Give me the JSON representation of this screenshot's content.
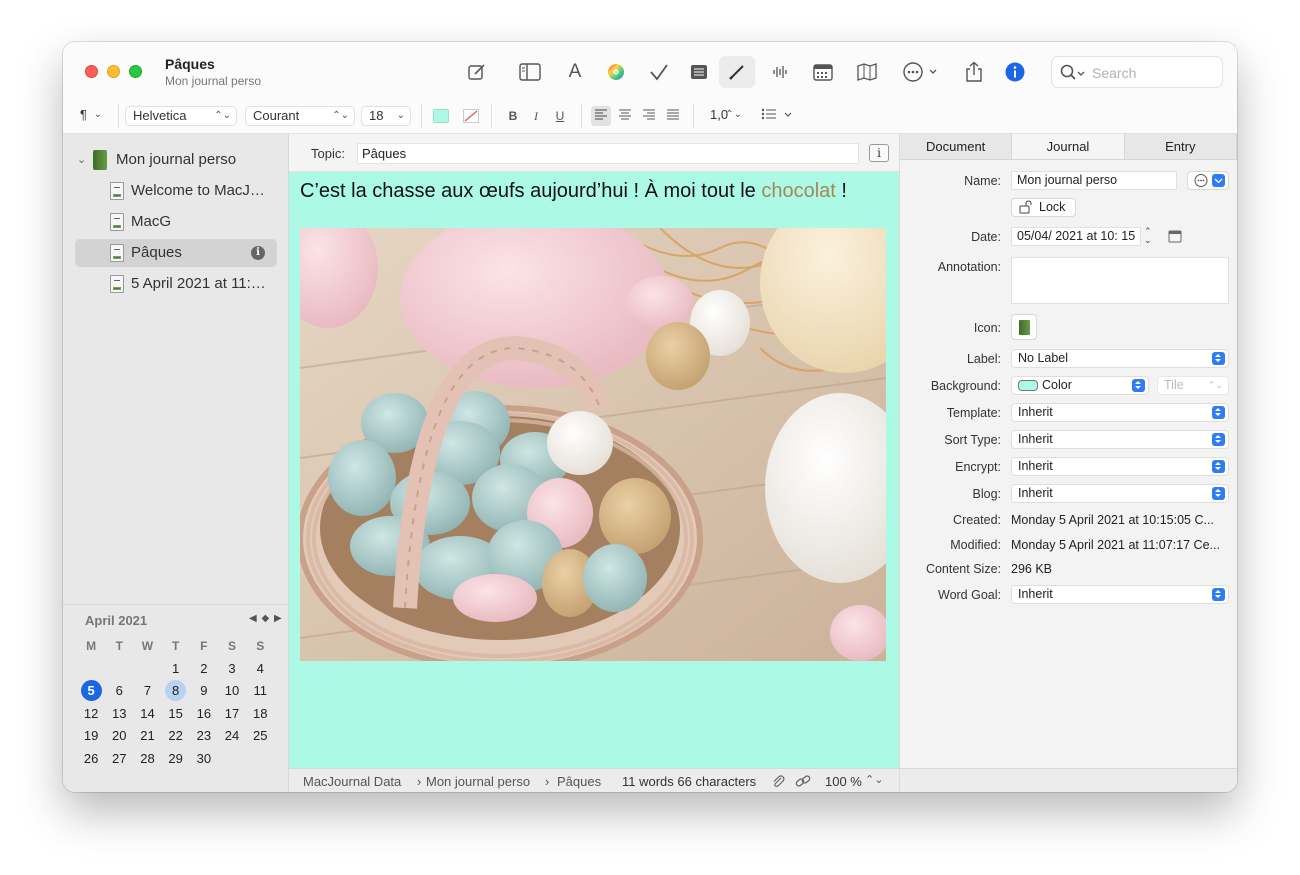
{
  "window": {
    "title": "Pâques",
    "subtitle": "Mon journal perso"
  },
  "toolbar": {
    "search_placeholder": "Search",
    "accent_color": "#1a66e3",
    "icons": [
      "compose-icon",
      "sidebar-icon",
      "font-icon",
      "color-wheel-icon",
      "checkmark-icon",
      "list-icon",
      "pen-icon",
      "waveform-icon",
      "calendar-icon",
      "map-icon",
      "more-icon",
      "share-icon",
      "info-icon"
    ]
  },
  "format_bar": {
    "paragraph": "¶",
    "font": "Helvetica",
    "style": "Courant",
    "size": "18",
    "bold": "B",
    "italic": "I",
    "underline": "U",
    "line_spacing": "1,0",
    "text_color": "#acfae6"
  },
  "sidebar": {
    "journal": "Mon journal perso",
    "items": [
      {
        "label": "Welcome to MacJ…"
      },
      {
        "label": "MacG"
      },
      {
        "label": "Pâques"
      },
      {
        "label": "5 April 2021 at 11:…"
      }
    ]
  },
  "calendar": {
    "month": "April 2021",
    "nav": "◀ ◆ ▶",
    "weekdays": [
      "M",
      "T",
      "W",
      "T",
      "F",
      "S",
      "S"
    ],
    "rows": [
      [
        "",
        "",
        "",
        "1",
        "2",
        "3",
        "4"
      ],
      [
        "5",
        "6",
        "7",
        "8",
        "9",
        "10",
        "11"
      ],
      [
        "12",
        "13",
        "14",
        "15",
        "16",
        "17",
        "18"
      ],
      [
        "19",
        "20",
        "21",
        "22",
        "23",
        "24",
        "25"
      ],
      [
        "26",
        "27",
        "28",
        "29",
        "30",
        "",
        ""
      ]
    ],
    "today": "5",
    "selected": "8"
  },
  "editor": {
    "topic_label": "Topic:",
    "topic_value": "Pâques",
    "text_before": "C’est la chasse aux œufs aujourd’hui ! À moi tout le ",
    "text_highlight": "chocolat",
    "text_after": " !",
    "background": "#acfae6",
    "highlight_color": "#a5865b"
  },
  "status": {
    "breadcrumb_1": "MacJournal Data",
    "breadcrumb_2": "Mon journal perso",
    "breadcrumb_3": "Pâques",
    "counts": "11 words 66 characters",
    "zoom": "100 %"
  },
  "inspector": {
    "tabs": [
      "Document",
      "Journal",
      "Entry"
    ],
    "active_tab": "Journal",
    "name_label": "Name:",
    "name_value": "Mon journal perso",
    "lock_label": "Lock",
    "date_label": "Date:",
    "date_value": "05/04/ 2021 at  10: 15",
    "annotation_label": "Annotation:",
    "icon_label": "Icon:",
    "label_label": "Label:",
    "label_value": "No Label",
    "background_label": "Background:",
    "background_value": "Color",
    "background_tile": "Tile",
    "template_label": "Template:",
    "template_value": "Inherit",
    "sort_label": "Sort Type:",
    "sort_value": "Inherit",
    "encrypt_label": "Encrypt:",
    "encrypt_value": "Inherit",
    "blog_label": "Blog:",
    "blog_value": "Inherit",
    "created_label": "Created:",
    "created_value": "Monday 5 April 2021 at 10:15:05 C...",
    "modified_label": "Modified:",
    "modified_value": "Monday 5 April 2021 at 11:07:17 Ce...",
    "size_label": "Content Size:",
    "size_value": "296 KB",
    "goal_label": "Word Goal:",
    "goal_value": "Inherit"
  }
}
